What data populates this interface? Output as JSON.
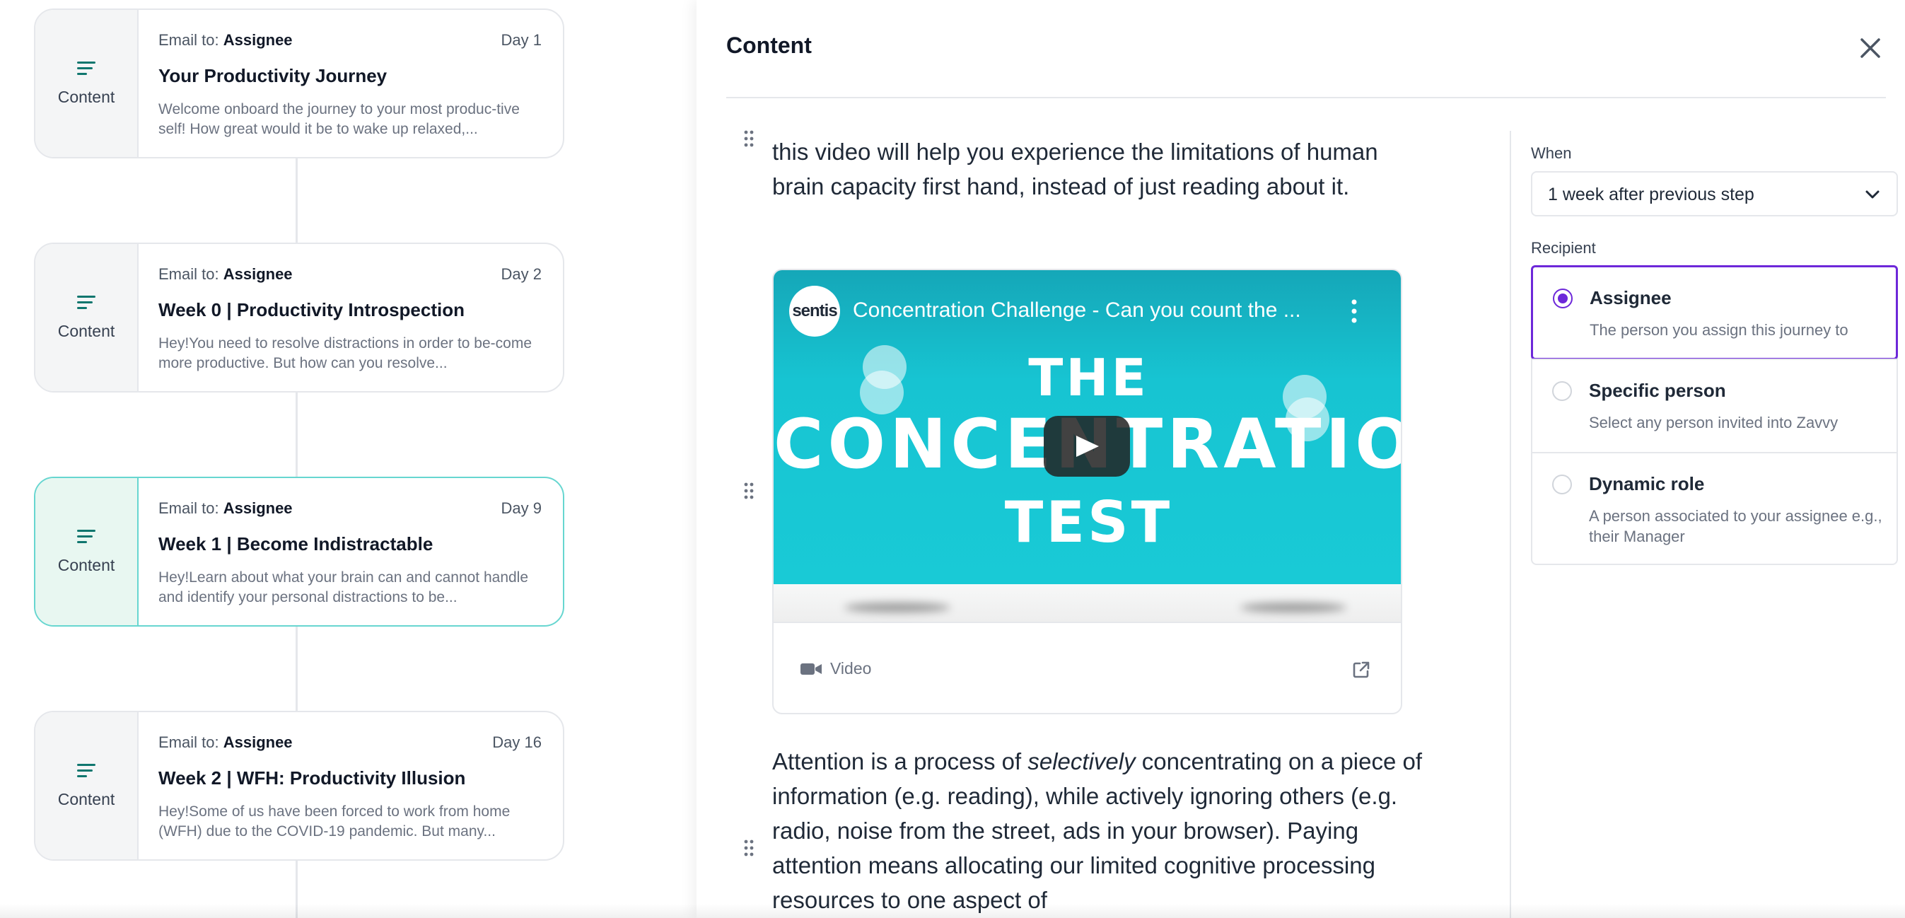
{
  "journey": {
    "steps": [
      {
        "type_label": "Content",
        "email_prefix": "Email to:",
        "recipient": "Assignee",
        "day": "Day 1",
        "title": "Your Productivity Journey",
        "description": "Welcome onboard the journey to your most produc-tive self! How great would it be to wake up relaxed,..."
      },
      {
        "type_label": "Content",
        "email_prefix": "Email to:",
        "recipient": "Assignee",
        "day": "Day 2",
        "title": "Week 0 | Productivity Introspection",
        "description": "Hey!You need to resolve distractions in order to be-come more productive. But how can you resolve..."
      },
      {
        "type_label": "Content",
        "email_prefix": "Email to:",
        "recipient": "Assignee",
        "day": "Day 9",
        "title": "Week 1 | Become Indistractable",
        "description": "Hey!Learn about what your brain can and cannot handle and identify your personal distractions to be..."
      },
      {
        "type_label": "Content",
        "email_prefix": "Email to:",
        "recipient": "Assignee",
        "day": "Day 16",
        "title": "Week 2 | WFH: Productivity Illusion",
        "description": "Hey!Some of us have been forced to work from home (WFH) due to the COVID-19 pandemic. But many..."
      }
    ]
  },
  "panel": {
    "title": "Content",
    "editor": {
      "intro_text": "this video will help you experience the limitations of human brain capacity first hand, instead of just reading about it.",
      "video": {
        "channel": "sentis",
        "title": "Concentration Challenge - Can you count the ...",
        "thumb_line1": "THE",
        "thumb_line2": "CONCENTRATION",
        "thumb_line3": "TEST",
        "footer_label": "Video"
      },
      "body_before": "Attention is a process of ",
      "body_em": "selectively",
      "body_after": " concentrating on a piece of information (e.g. reading), while actively ignoring others (e.g. radio, noise from the street, ads in your browser). Paying attention means allocating our limited cognitive processing resources to one aspect of"
    },
    "settings": {
      "when_label": "When",
      "when_value": "1 week after previous step",
      "recipient_label": "Recipient",
      "options": [
        {
          "name": "Assignee",
          "desc": "The person you assign this journey to",
          "selected": true
        },
        {
          "name": "Specific person",
          "desc": "Select any person invited into Zavvy",
          "selected": false
        },
        {
          "name": "Dynamic role",
          "desc": "A person associated to your assignee e.g., their Manager",
          "selected": false
        }
      ]
    }
  },
  "colors": {
    "accent": "#6d28d9",
    "teal": "#0f766e",
    "active_border": "#67d6d0",
    "active_bg": "#e8f7f1"
  }
}
